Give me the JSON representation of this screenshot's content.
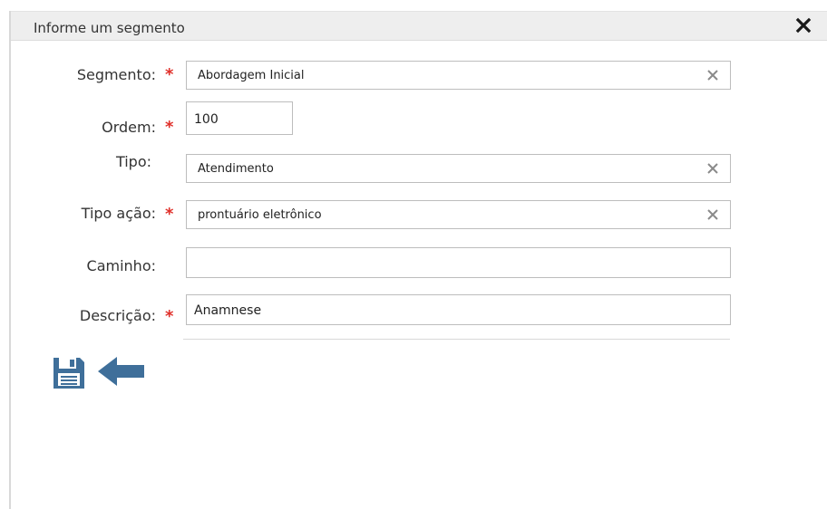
{
  "dialog": {
    "title": "Informe um segmento",
    "close_icon": "close-icon"
  },
  "form": {
    "segmento": {
      "label": "Segmento:",
      "required": "*",
      "value": "Abordagem Inicial"
    },
    "ordem": {
      "label": "Ordem:",
      "required": "*",
      "value": "100"
    },
    "tipo": {
      "label": "Tipo:",
      "value": "Atendimento"
    },
    "tipo_acao": {
      "label": "Tipo ação:",
      "required": "*",
      "value": "prontuário eletrônico"
    },
    "caminho": {
      "label": "Caminho:",
      "value": ""
    },
    "descricao": {
      "label": "Descrição:",
      "required": "*",
      "value": "Anamnese"
    }
  },
  "actions": {
    "save_icon": "floppy-disk-icon",
    "back_icon": "arrow-left-icon"
  },
  "colors": {
    "required": "#e0302a",
    "icon": "#3f6f9a"
  }
}
